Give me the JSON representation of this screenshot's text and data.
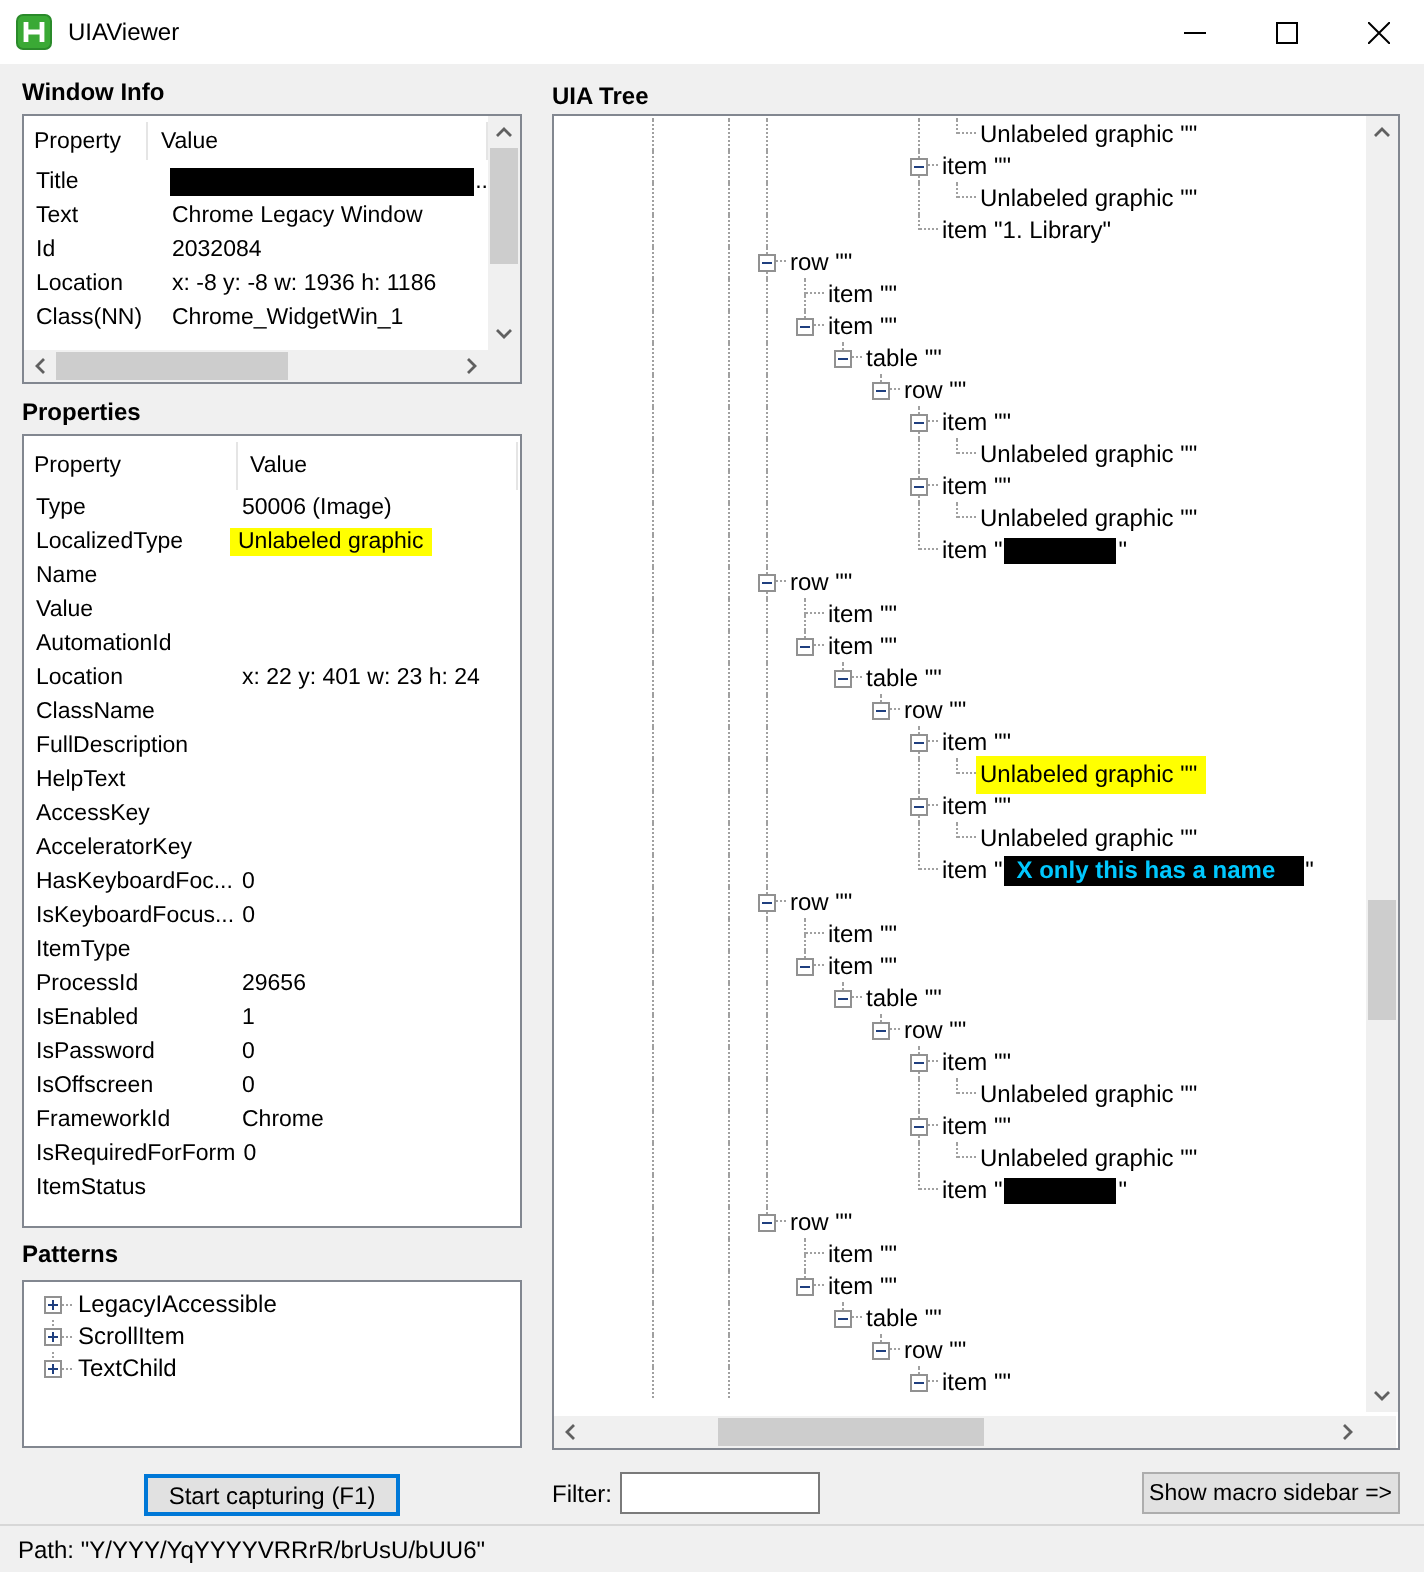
{
  "window": {
    "title": "UIAViewer"
  },
  "window_info": {
    "label": "Window Info",
    "columns": [
      "Property",
      "Value"
    ],
    "rows": [
      {
        "property": "Title",
        "value": "..",
        "redacted": true
      },
      {
        "property": "Text",
        "value": "Chrome Legacy Window"
      },
      {
        "property": "Id",
        "value": "2032084"
      },
      {
        "property": "Location",
        "value": "x: -8 y: -8 w: 1936 h: 1186"
      },
      {
        "property": "Class(NN)",
        "value": "Chrome_WidgetWin_1"
      }
    ]
  },
  "properties": {
    "label": "Properties",
    "columns": [
      "Property",
      "Value"
    ],
    "rows": [
      {
        "property": "Type",
        "value": "50006 (Image)"
      },
      {
        "property": "LocalizedType",
        "value": "Unlabeled graphic",
        "highlighted": true
      },
      {
        "property": "Name"
      },
      {
        "property": "Value"
      },
      {
        "property": "AutomationId"
      },
      {
        "property": "Location",
        "value": "x: 22 y: 401 w: 23 h: 24"
      },
      {
        "property": "ClassName"
      },
      {
        "property": "FullDescription"
      },
      {
        "property": "HelpText"
      },
      {
        "property": "AccessKey"
      },
      {
        "property": "AcceleratorKey"
      },
      {
        "property": "HasKeyboardFoc...",
        "value": "0"
      },
      {
        "property": "IsKeyboardFocus...",
        "value": "0"
      },
      {
        "property": "ItemType"
      },
      {
        "property": "ProcessId",
        "value": "29656"
      },
      {
        "property": "IsEnabled",
        "value": "1"
      },
      {
        "property": "IsPassword",
        "value": "0"
      },
      {
        "property": "IsOffscreen",
        "value": "0"
      },
      {
        "property": "FrameworkId",
        "value": "Chrome"
      },
      {
        "property": "IsRequiredForForm",
        "value": "0"
      },
      {
        "property": "ItemStatus"
      }
    ]
  },
  "patterns": {
    "label": "Patterns",
    "items": [
      {
        "label": "LegacyIAccessible",
        "expanded": false
      },
      {
        "label": "ScrollItem",
        "expanded": false
      },
      {
        "label": "TextChild",
        "expanded": false
      }
    ]
  },
  "start_button": {
    "label": "Start capturing (F1)"
  },
  "uia_tree": {
    "label": "UIA Tree",
    "nodes": [
      {
        "children": [
          {
            "children": [
              {
                "children": [
                  {
                    "children": [
                      {
                        "children": [
                          {
                            "label": "Unlabeled graphic \"\""
                          }
                        ]
                      },
                      {
                        "label": "item \"\"",
                        "expanded": true,
                        "children": [
                          {
                            "label": "Unlabeled graphic \"\""
                          }
                        ]
                      },
                      {
                        "label": "item \"1. Library\""
                      }
                    ]
                  }
                ]
              }
            ]
          }
        ]
      },
      {
        "label": "row \"\"",
        "expanded": true,
        "children": [
          {
            "label": "item \"\""
          },
          {
            "label": "item \"\"",
            "expanded": true,
            "children": [
              {
                "label": "table \"\"",
                "expanded": true,
                "children": [
                  {
                    "label": "row \"\"",
                    "expanded": true,
                    "children": [
                      {
                        "label": "item \"\"",
                        "expanded": true,
                        "children": [
                          {
                            "label": "Unlabeled graphic \"\""
                          }
                        ]
                      },
                      {
                        "label": "item \"\"",
                        "expanded": true,
                        "children": [
                          {
                            "label": "Unlabeled graphic \"\""
                          }
                        ]
                      },
                      {
                        "label": "item \"",
                        "redacted": true,
                        "label_end": "\""
                      }
                    ]
                  }
                ]
              }
            ]
          }
        ]
      },
      {
        "label": "row \"\"",
        "expanded": true,
        "children": [
          {
            "label": "item \"\""
          },
          {
            "label": "item \"\"",
            "expanded": true,
            "children": [
              {
                "label": "table \"\"",
                "expanded": true,
                "children": [
                  {
                    "label": "row \"\"",
                    "expanded": true,
                    "children": [
                      {
                        "label": "item \"\"",
                        "expanded": true,
                        "children": [
                          {
                            "label": "Unlabeled graphic \"\"",
                            "highlighted": true
                          }
                        ]
                      },
                      {
                        "label": "item \"\"",
                        "expanded": true,
                        "children": [
                          {
                            "label": "Unlabeled graphic \"\""
                          }
                        ]
                      },
                      {
                        "label": "item \"",
                        "tag": "X only this has a name",
                        "label_end": "\""
                      }
                    ]
                  }
                ]
              }
            ]
          }
        ]
      },
      {
        "label": "row \"\"",
        "expanded": true,
        "children": [
          {
            "label": "item \"\""
          },
          {
            "label": "item \"\"",
            "expanded": true,
            "children": [
              {
                "label": "table \"\"",
                "expanded": true,
                "children": [
                  {
                    "label": "row \"\"",
                    "expanded": true,
                    "children": [
                      {
                        "label": "item \"\"",
                        "expanded": true,
                        "children": [
                          {
                            "label": "Unlabeled graphic \"\""
                          }
                        ]
                      },
                      {
                        "label": "item \"\"",
                        "expanded": true,
                        "children": [
                          {
                            "label": "Unlabeled graphic \"\""
                          }
                        ]
                      },
                      {
                        "label": "item \"",
                        "redacted": true,
                        "label_end": "\""
                      }
                    ]
                  }
                ]
              }
            ]
          }
        ]
      },
      {
        "label": "row \"\"",
        "expanded": true,
        "children": [
          {
            "label": "item \"\""
          },
          {
            "label": "item \"\"",
            "expanded": true,
            "children": [
              {
                "label": "table \"\"",
                "expanded": true,
                "children": [
                  {
                    "label": "row \"\"",
                    "expanded": true,
                    "children": [
                      {
                        "label": "item \"\"",
                        "expanded": true
                      }
                    ]
                  }
                ]
              }
            ]
          }
        ]
      }
    ]
  },
  "filter": {
    "label": "Filter:"
  },
  "macro_button": {
    "label": "Show macro sidebar =>"
  },
  "status_bar": {
    "path": "Path: \"Y/YYY/YqYYYYVRRrR/brUsU/bUU6\""
  }
}
